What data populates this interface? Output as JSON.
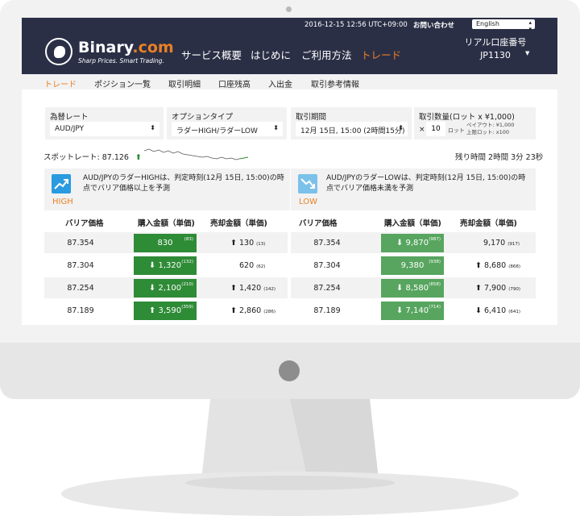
{
  "topbar": {
    "datetime": "2016-12-15 12:56 UTC+09:00",
    "contact": "お問い合わせ",
    "language": "English"
  },
  "header": {
    "brand": "Binary",
    "brand_suffix": ".com",
    "tagline": "Sharp Prices. Smart Trading.",
    "nav": [
      "サービス概要",
      "はじめに",
      "ご利用方法",
      "トレード"
    ],
    "account_label": "リアル口座番号",
    "account_number": "JP1130"
  },
  "subnav": [
    "トレード",
    "ポジション一覧",
    "取引明細",
    "口座残高",
    "入出金",
    "取引参考情報"
  ],
  "panels": {
    "rate_label": "為替レート",
    "rate_value": "AUD/JPY",
    "option_label": "オプションタイプ",
    "option_value": "ラダーHIGH/ラダーLOW",
    "period_label": "取引期間",
    "period_value": "12月 15日, 15:00 (2時間15分)",
    "lot_label": "取引数量(ロット x ¥1,000)",
    "lot_x": "×",
    "lot_value": "10",
    "lot_unit": "ロット",
    "payout_line1": "ペイアウト: ¥1,000",
    "payout_line2": "上限ロット: x100"
  },
  "spot": {
    "label": "スポットレート: 87.126",
    "arrow": "⬆",
    "remaining": "残り時間 2時間 3分 23秒"
  },
  "contracts": {
    "high": {
      "desc": "AUD/JPYのラダーHIGHは、判定時刻(12月 15日, 15:00)の時点でバリア価格以上を予測",
      "name": "HIGH"
    },
    "low": {
      "desc": "AUD/JPYのラダーLOWは、判定時刻(12月 15日, 15:00)の時点でバリア価格未満を予測",
      "name": "LOW"
    }
  },
  "columns": {
    "barrier": "バリア価格",
    "buy": "購入金額（単価)",
    "sell": "売却金額（単価)"
  },
  "rows": [
    {
      "barrier": "87.354",
      "high_buy": "830",
      "high_buy_unit": "(83)",
      "high_sell": "⬆ 130",
      "high_sell_unit": "(13)",
      "low_buy": "⬇ 9,870",
      "low_buy_unit": "(987)",
      "low_sell": "9,170",
      "low_sell_unit": "(917)"
    },
    {
      "barrier": "87.304",
      "high_buy": "⬇ 1,320",
      "high_buy_unit": "(132)",
      "high_sell": "620",
      "high_sell_unit": "(62)",
      "low_buy": "9,380",
      "low_buy_unit": "(938)",
      "low_sell": "⬆ 8,680",
      "low_sell_unit": "(868)"
    },
    {
      "barrier": "87.254",
      "high_buy": "⬇ 2,100",
      "high_buy_unit": "(210)",
      "high_sell": "⬆ 1,420",
      "high_sell_unit": "(142)",
      "low_buy": "⬇ 8,580",
      "low_buy_unit": "(858)",
      "low_sell": "⬆ 7,900",
      "low_sell_unit": "(790)"
    },
    {
      "barrier": "87.189",
      "high_buy": "⬆ 3,590",
      "high_buy_unit": "(359)",
      "high_sell": "⬆ 2,860",
      "high_sell_unit": "(286)",
      "low_buy": "⬇ 7,140",
      "low_buy_unit": "(714)",
      "low_sell": "⬇ 6,410",
      "low_sell_unit": "(641)"
    }
  ],
  "colors": {
    "accent": "#e98024",
    "navbar": "#2b2f46",
    "buy_dark": "#2e8b36",
    "buy_light": "#57a55f"
  }
}
